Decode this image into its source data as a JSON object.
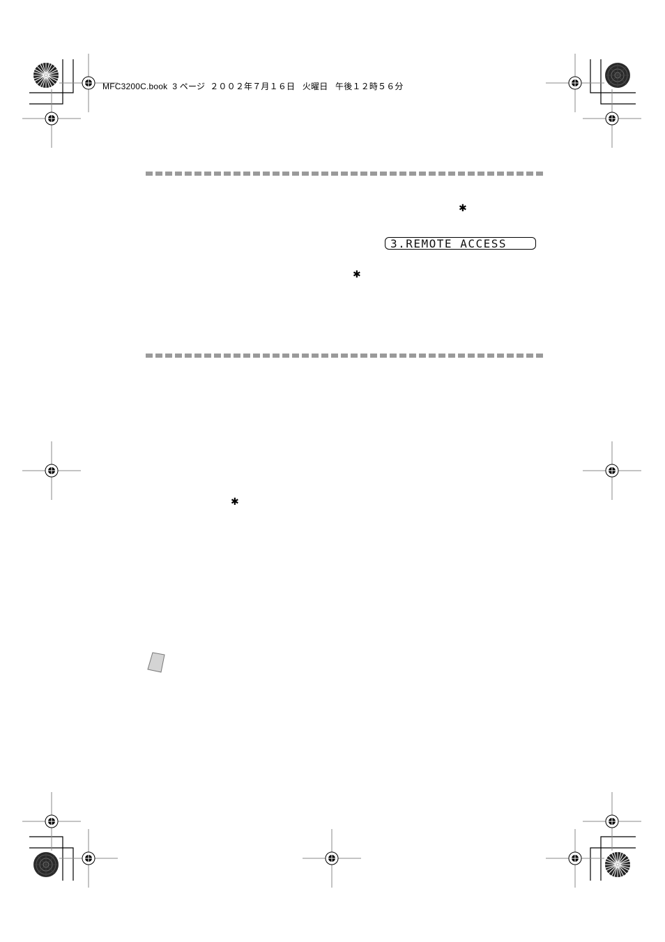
{
  "header": {
    "text": "MFC3200C.book  3 ページ  ２００２年７月１６日   火曜日   午後１２時５６分"
  },
  "lcd_display": {
    "text": "3.REMOTE ACCESS"
  },
  "symbols": {
    "star_1": "✱",
    "star_2": "✱",
    "star_3": "✱"
  },
  "icons": {
    "note": "note-icon",
    "registration_mark": "crosshair-registration-icon",
    "color_wheel": "color-wheel-icon"
  }
}
